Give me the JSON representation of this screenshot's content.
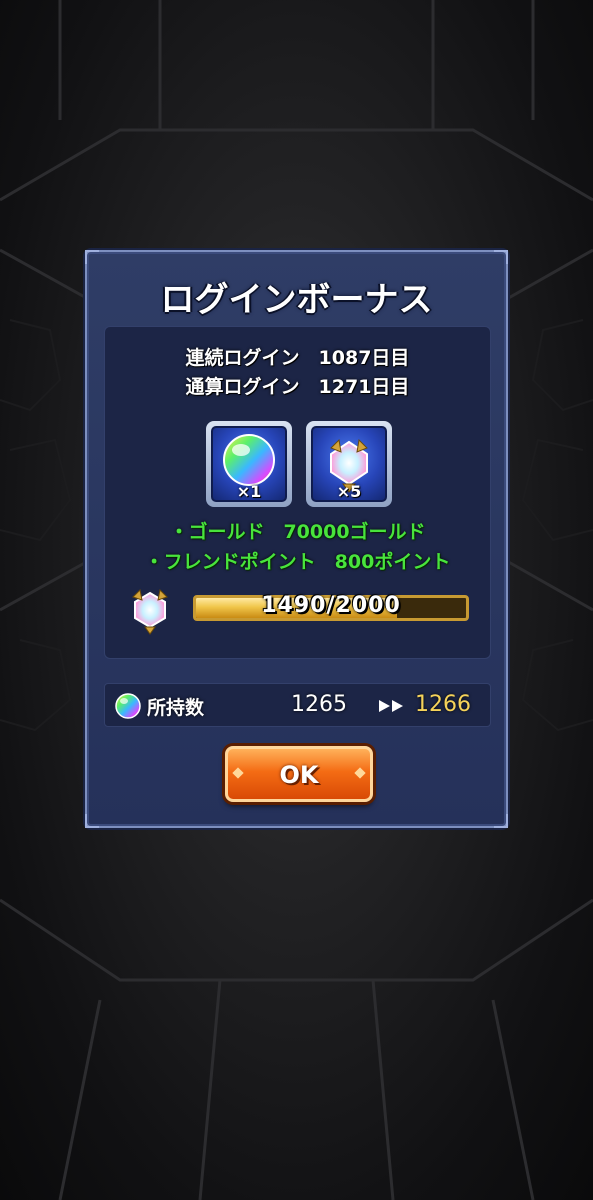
{
  "dialog": {
    "title": "ログインボーナス",
    "consecutive_login": "連続ログイン　1087日目",
    "total_login": "通算ログイン　1271日目",
    "rewards": [
      {
        "icon": "rainbow-orb-icon",
        "count": "×1"
      },
      {
        "icon": "crystal-shard-icon",
        "count": "×5"
      }
    ],
    "bonus_lines": [
      "・ゴールド　70000ゴールド",
      "・フレンドポイント　800ポイント"
    ],
    "progress": {
      "text": "1490/2000",
      "value": 1490,
      "max": 2000
    },
    "owned": {
      "label": "所持数",
      "before": "1265",
      "after": "1266"
    },
    "ok_label": "OK"
  },
  "colors": {
    "bonus_green": "#48e43c",
    "after_gold": "#f6d35a",
    "button_orange": "#f46c14"
  }
}
